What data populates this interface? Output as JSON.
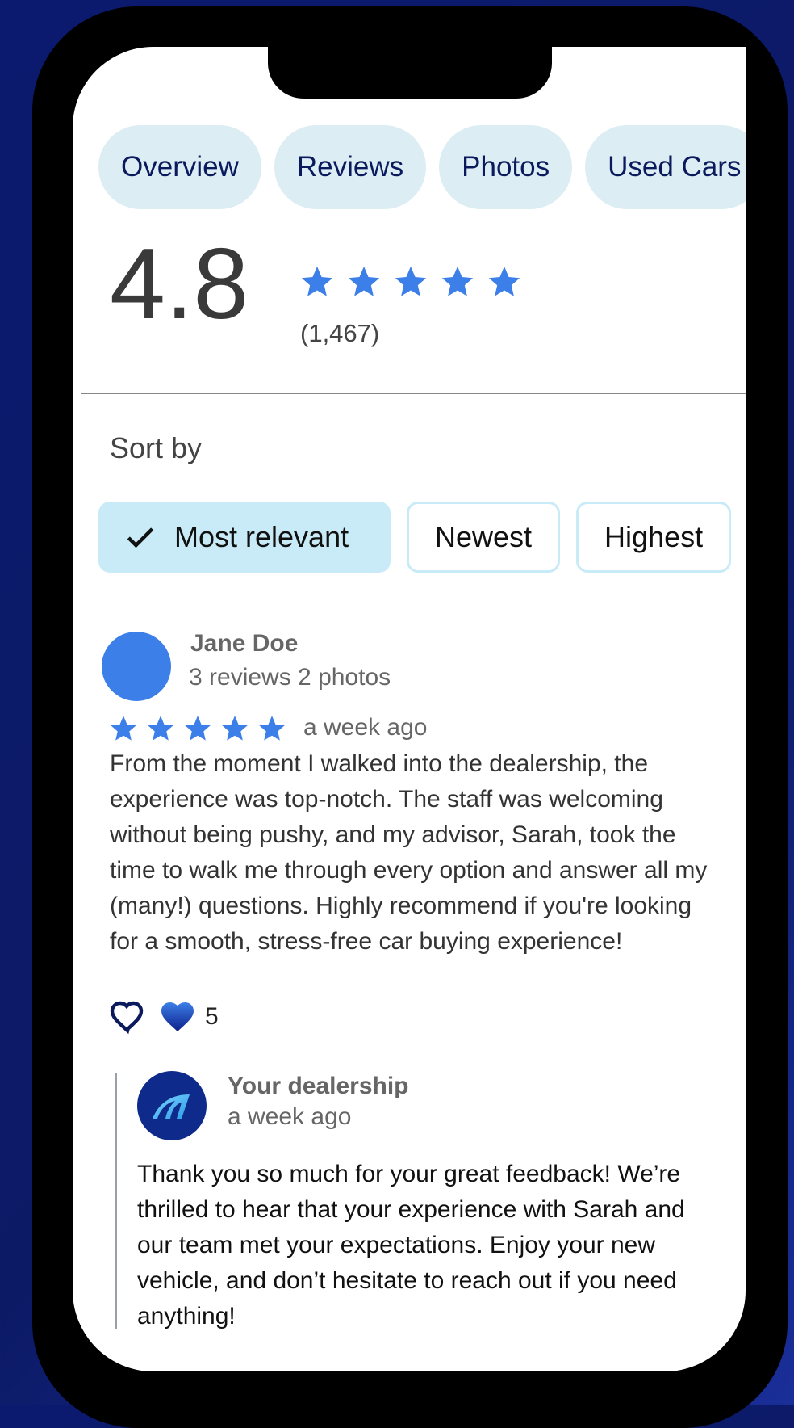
{
  "tabs": [
    {
      "label": "Overview"
    },
    {
      "label": "Reviews"
    },
    {
      "label": "Photos"
    },
    {
      "label": "Used Cars"
    }
  ],
  "summary": {
    "rating": "4.8",
    "stars": 5,
    "count": "(1,467)"
  },
  "sort": {
    "label": "Sort by",
    "options": [
      {
        "label": "Most relevant",
        "selected": true
      },
      {
        "label": "Newest",
        "selected": false
      },
      {
        "label": "Highest",
        "selected": false
      }
    ]
  },
  "review": {
    "author": "Jane Doe",
    "meta": "3 reviews  2 photos",
    "stars": 5,
    "date": "a week ago",
    "text": "From the moment I walked into the dealership, the experience was top-notch. The staff was welcoming without being pushy, and my advisor, Sarah, took the time to walk me through every option and answer all my (many!) questions. Highly recommend if you're looking for a smooth, stress-free car buying experience!",
    "like_count": "5"
  },
  "reply": {
    "author": "Your dealership",
    "date": "a week ago",
    "text": "Thank you so much for your great feedback! We’re thrilled to hear that your experience with Sarah and our team met your expectations. Enjoy your new vehicle, and don’t hesitate to reach out if you need anything!"
  },
  "colors": {
    "accent": "#3d7fe8",
    "tab_bg": "#dcedf3",
    "chip_active": "#c8ebf7",
    "brand_dark": "#0e2a8a"
  },
  "icons": {
    "star": "star-icon",
    "check": "check-icon",
    "heart_outline": "heart-outline-icon",
    "heart_filled": "heart-filled-icon",
    "logo": "dealership-logo-icon"
  }
}
